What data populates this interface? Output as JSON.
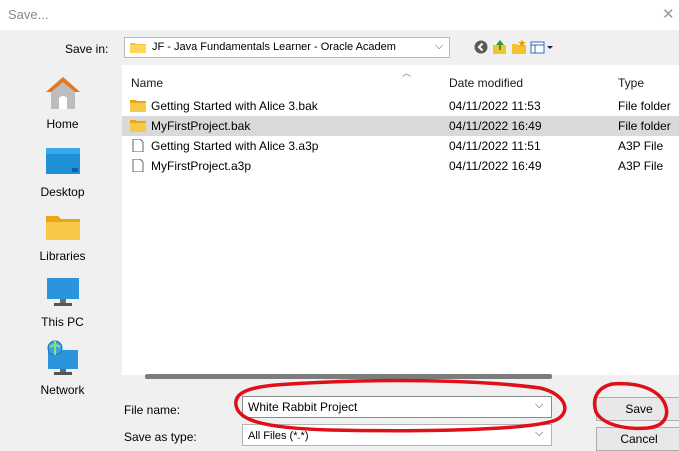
{
  "window": {
    "title": "Save...",
    "close_glyph": "✕"
  },
  "toolbar": {
    "save_in_label": "Save in:",
    "save_in_value": "JF - Java Fundamentals Learner - Oracle Academ",
    "icons": [
      "back-icon",
      "up-folder-icon",
      "new-folder-icon",
      "view-menu-icon"
    ]
  },
  "places": [
    {
      "label": "Home",
      "icon": "home-icon"
    },
    {
      "label": "Desktop",
      "icon": "desktop-icon"
    },
    {
      "label": "Libraries",
      "icon": "libraries-icon"
    },
    {
      "label": "This PC",
      "icon": "computer-icon"
    },
    {
      "label": "Network",
      "icon": "network-icon"
    }
  ],
  "files": {
    "columns": [
      "Name",
      "Date modified",
      "Type"
    ],
    "rows": [
      {
        "name": "Getting Started with Alice 3.bak",
        "date": "04/11/2022 11:53",
        "type": "File folder",
        "kind": "folder",
        "selected": false
      },
      {
        "name": "MyFirstProject.bak",
        "date": "04/11/2022 16:49",
        "type": "File folder",
        "kind": "folder",
        "selected": true
      },
      {
        "name": "Getting Started with Alice 3.a3p",
        "date": "04/11/2022 11:51",
        "type": "A3P File",
        "kind": "file",
        "selected": false
      },
      {
        "name": "MyFirstProject.a3p",
        "date": "04/11/2022 16:49",
        "type": "A3P File",
        "kind": "file",
        "selected": false
      }
    ]
  },
  "form": {
    "file_name_label": "File name:",
    "file_name_value": "White Rabbit Project",
    "save_as_type_label": "Save as type:",
    "save_as_type_value": "All Files (*.*)"
  },
  "buttons": {
    "save": "Save",
    "cancel": "Cancel"
  },
  "colors": {
    "annotation": "#e0101a",
    "folder": "#f5c33b",
    "selection": "#d9d9d9"
  }
}
